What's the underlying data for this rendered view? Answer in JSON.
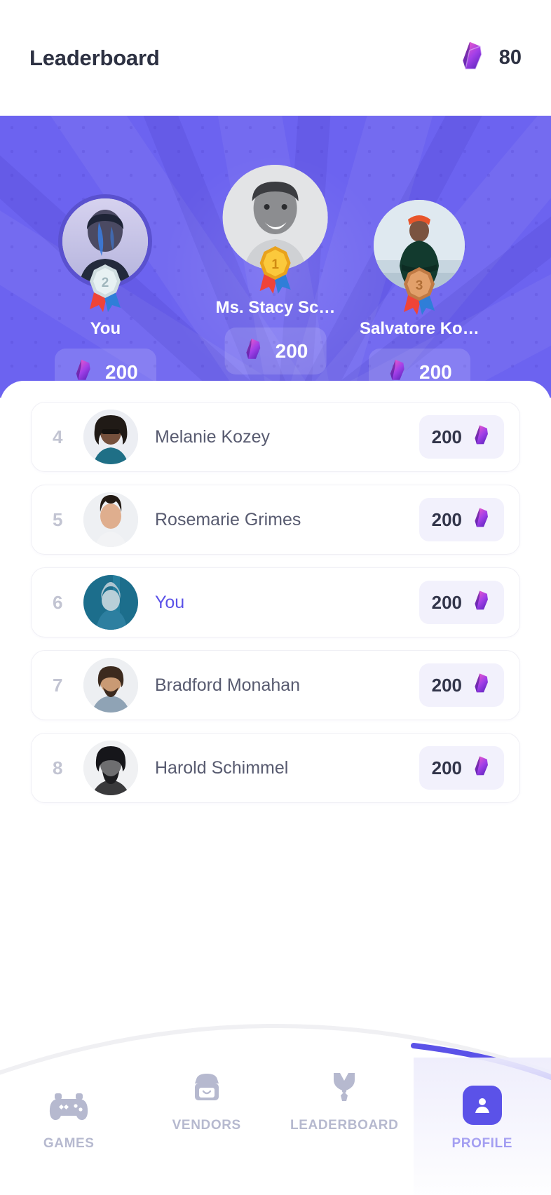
{
  "header": {
    "title": "Leaderboard",
    "gem_icon": "gem-icon",
    "score": "80"
  },
  "podium": {
    "background_color": "#6c63f0",
    "entries": [
      {
        "rank": "2",
        "name": "You",
        "score": "200",
        "medal": "silver-medal-icon",
        "gem_icon": "gem-icon"
      },
      {
        "rank": "1",
        "name": "Ms. Stacy Sc…",
        "score": "200",
        "medal": "gold-medal-icon",
        "gem_icon": "gem-icon"
      },
      {
        "rank": "3",
        "name": "Salvatore Ko…",
        "score": "200",
        "medal": "bronze-medal-icon",
        "gem_icon": "gem-icon"
      }
    ]
  },
  "list": {
    "rows": [
      {
        "rank": "4",
        "name": "Melanie Kozey",
        "score": "200",
        "is_me": false
      },
      {
        "rank": "5",
        "name": "Rosemarie Grimes",
        "score": "200",
        "is_me": false
      },
      {
        "rank": "6",
        "name": "You",
        "score": "200",
        "is_me": true
      },
      {
        "rank": "7",
        "name": "Bradford Monahan",
        "score": "200",
        "is_me": false
      },
      {
        "rank": "8",
        "name": "Harold Schimmel",
        "score": "200",
        "is_me": false
      }
    ]
  },
  "bottom_nav": {
    "active_color": "#5b52e8",
    "inactive_color": "#b6b9cf",
    "items": [
      {
        "label": "GAMES",
        "icon": "gamepad-icon",
        "active": false
      },
      {
        "label": "VENDORS",
        "icon": "storefront-icon",
        "active": false
      },
      {
        "label": "LEADERBOARD",
        "icon": "medal-icon",
        "active": false
      },
      {
        "label": "PROFILE",
        "icon": "person-icon",
        "active": true
      }
    ]
  }
}
